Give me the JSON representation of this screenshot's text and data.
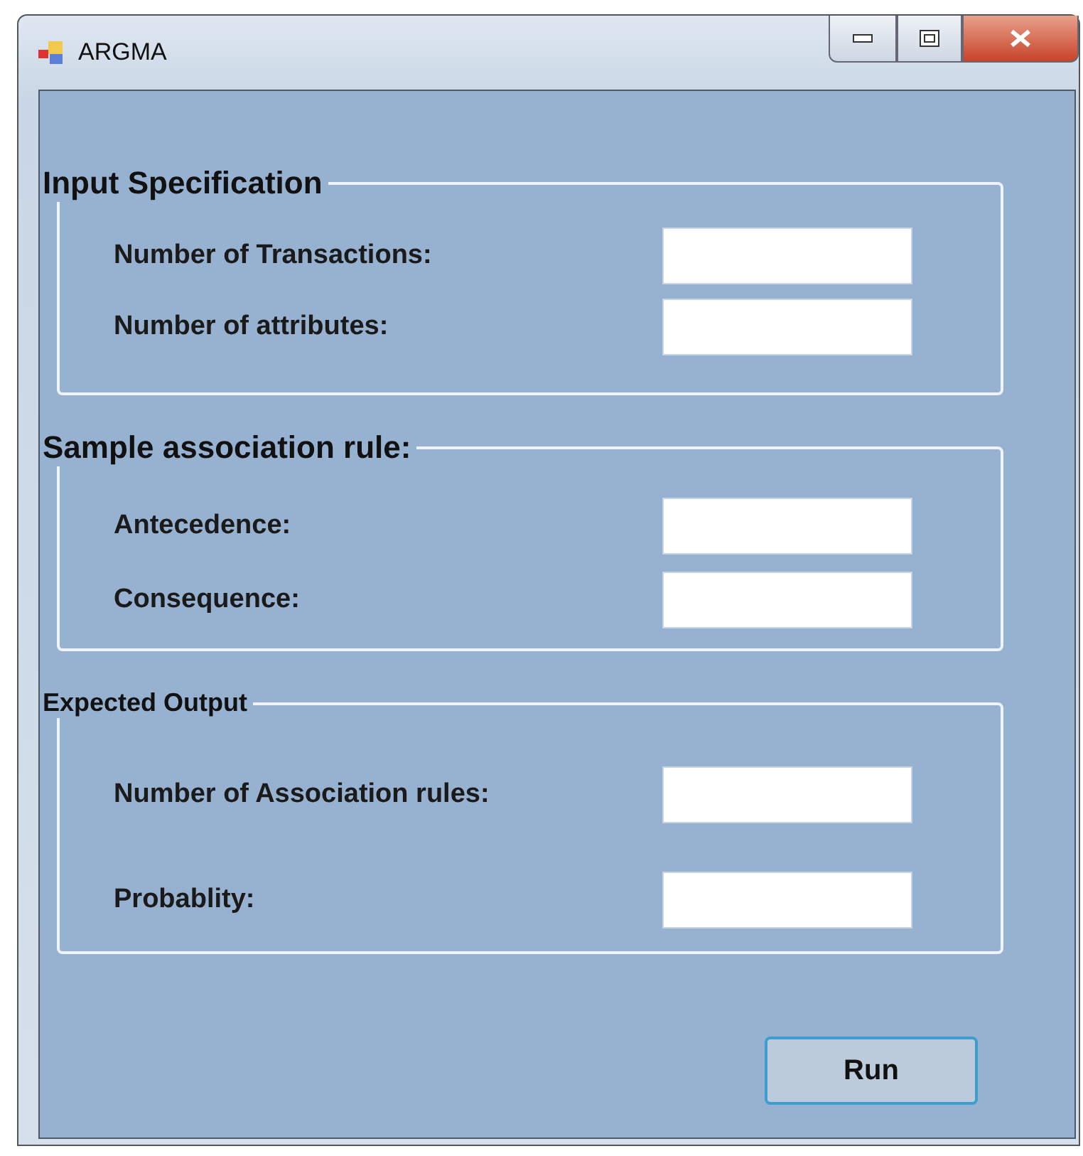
{
  "window": {
    "title": "ARGMA"
  },
  "groups": [
    {
      "title": "Input Specification",
      "fields": [
        {
          "label": "Number of Transactions:"
        },
        {
          "label": "Number of attributes:"
        }
      ]
    },
    {
      "title": "Sample association rule:",
      "fields": [
        {
          "label": "Antecedence:"
        },
        {
          "label": "Consequence:"
        }
      ]
    },
    {
      "title": "Expected Output",
      "fields": [
        {
          "label": "Number of Association rules:"
        },
        {
          "label": "Probablity:"
        }
      ]
    }
  ],
  "buttons": [
    {
      "label": "Run"
    }
  ]
}
